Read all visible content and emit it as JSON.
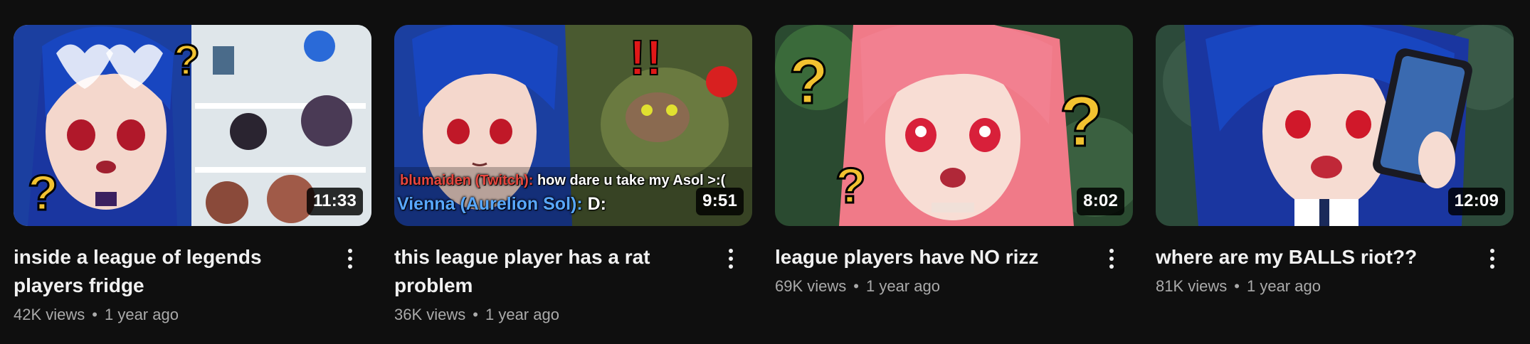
{
  "videos": [
    {
      "title": "inside a league of legends players fridge",
      "views": "42K views",
      "age": "1 year ago",
      "duration": "11:33",
      "colors": {
        "bg": "#b8c4cf",
        "accent": "#1b3fa0"
      }
    },
    {
      "title": "this league player has a rat problem",
      "views": "36K views",
      "age": "1 year ago",
      "duration": "9:51",
      "overlay": {
        "line1_name": "blumaiden (Twitch):",
        "line1_text": " how dare u take my Asol >:(",
        "line2_name": "Vienna (Aurelion Sol):",
        "line2_text": " D:"
      },
      "colors": {
        "bg": "#3d4d2a",
        "accent": "#1b3fa0"
      }
    },
    {
      "title": "league players have NO rizz",
      "views": "69K views",
      "age": "1 year ago",
      "duration": "8:02",
      "colors": {
        "bg": "#2f5a3a",
        "accent": "#f08a95"
      }
    },
    {
      "title": "where are my BALLS riot??",
      "views": "81K views",
      "age": "1 year ago",
      "duration": "12:09",
      "colors": {
        "bg": "#2b4a3c",
        "accent": "#1b3fa0"
      }
    }
  ],
  "separator": "•"
}
